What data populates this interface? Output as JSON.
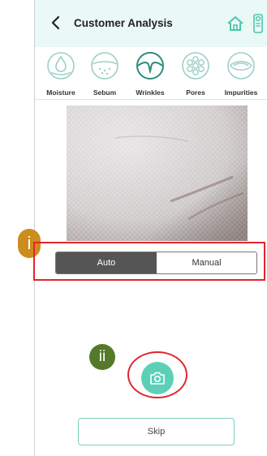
{
  "header": {
    "title": "Customer Analysis"
  },
  "categories": [
    {
      "label": "Moisture",
      "icon": "moisture-icon"
    },
    {
      "label": "Sebum",
      "icon": "sebum-icon"
    },
    {
      "label": "Wrinkles",
      "icon": "wrinkles-icon"
    },
    {
      "label": "Pores",
      "icon": "pores-icon"
    },
    {
      "label": "Impurities",
      "icon": "impurities-icon"
    }
  ],
  "mode_toggle": {
    "auto_label": "Auto",
    "manual_label": "Manual",
    "selected": "Auto"
  },
  "annotations": {
    "badge_1": "i",
    "badge_2": "ii"
  },
  "skip_button": {
    "label": "Skip"
  },
  "colors": {
    "header_bg": "#eaf8f6",
    "accent": "#5bd0b7",
    "selected_segment": "#555555",
    "highlight_red": "#e0262e",
    "badge_1": "#cc8d1d",
    "badge_2": "#547a29"
  }
}
